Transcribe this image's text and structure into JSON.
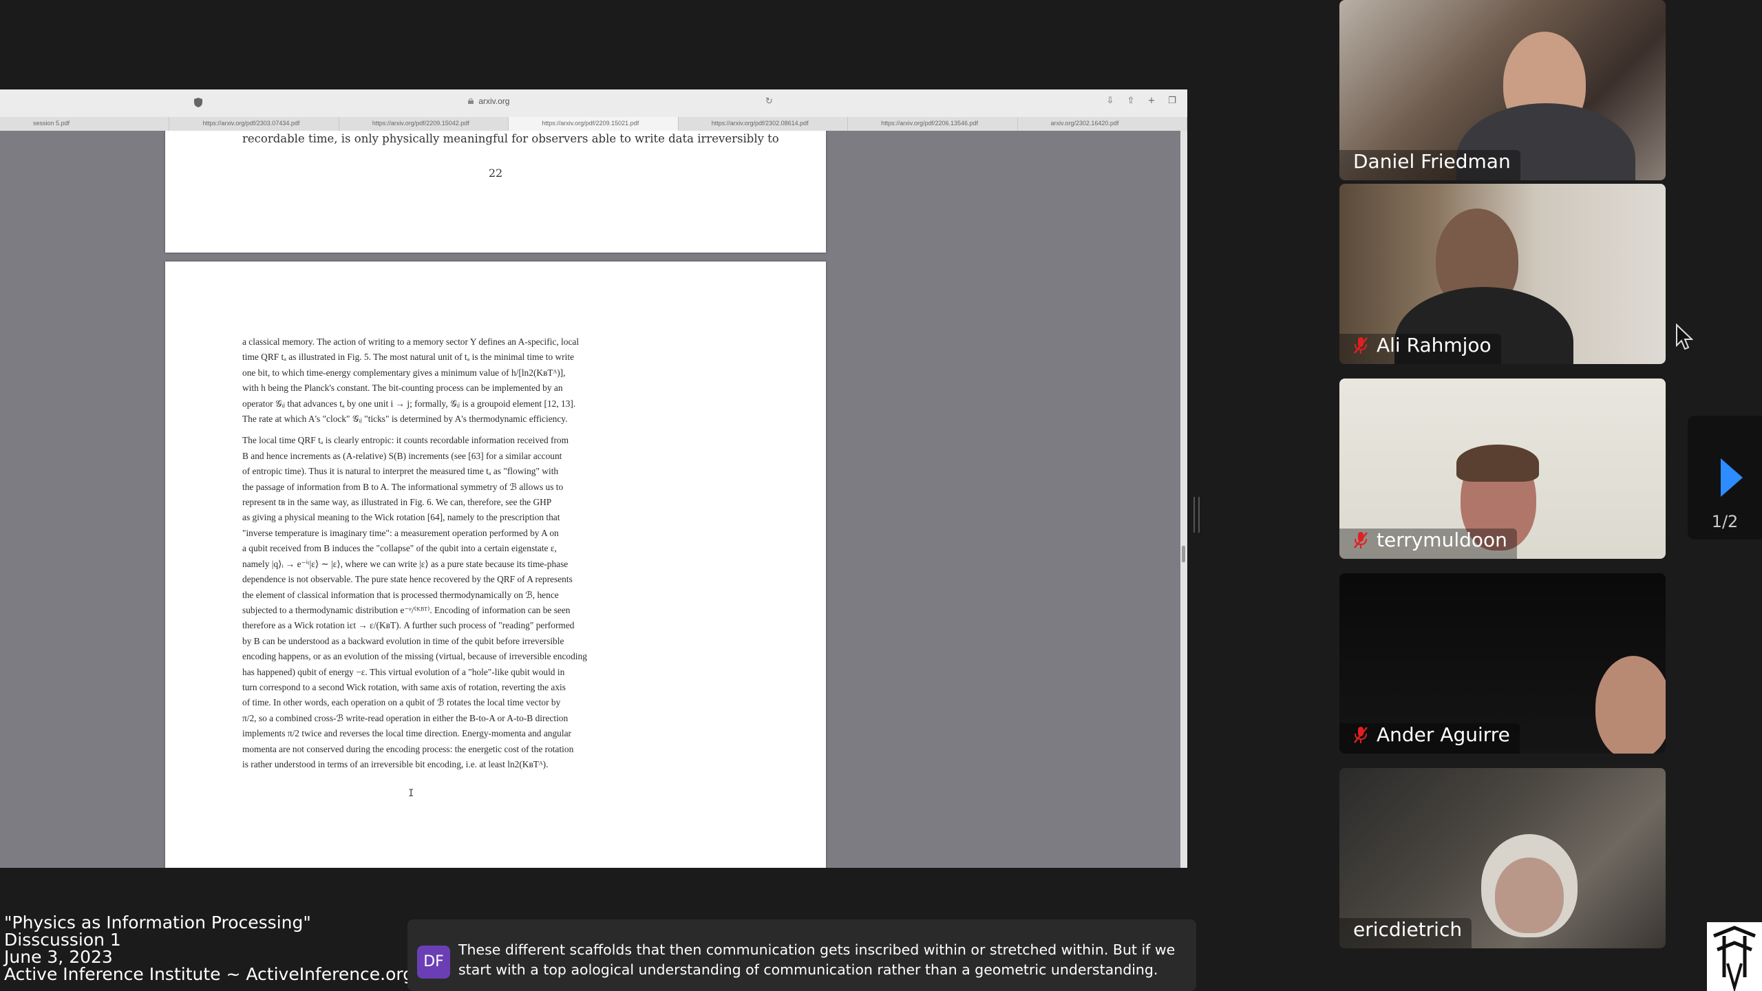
{
  "browser": {
    "url": "arxiv.org",
    "tabs": [
      "session 5.pdf",
      "https://arxiv.org/pdf/2303.07434.pdf",
      "https://arxiv.org/pdf/2209.15042.pdf",
      "https://arxiv.org/pdf/2209.15021.pdf",
      "https://arxiv.org/pdf/2302.08614.pdf",
      "https://arxiv.org/pdf/2206.13546.pdf",
      "arxiv.org/2302.16420.pdf"
    ]
  },
  "document": {
    "prev_page_last_line": "recordable time, is only physically meaningful for observers able to write data irreversibly to",
    "page_number": "22",
    "paragraph1": [
      "a classical memory. The action of writing to a memory sector Y defines an A-specific, local",
      "time QRF tₐ as illustrated in Fig. 5. The most natural unit of tₐ is the minimal time to write",
      "one bit, to which time-energy complementary gives a minimum value of h/[ln2(KʙTᴬ)],",
      "with h being the Planck's constant. The bit-counting process can be implemented by an",
      "operator 𝒢ᵢⱼ that advances tₐ by one unit i → j; formally, 𝒢ᵢⱼ is a groupoid element [12, 13].",
      "The rate at which A's \"clock\" 𝒢ᵢⱼ \"ticks\" is determined by A's thermodynamic efficiency."
    ],
    "paragraph2": [
      "The local time QRF tₐ is clearly entropic: it counts recordable information received from",
      "B and hence increments as (A-relative) S(B) increments (see [63] for a similar account",
      "of entropic time). Thus it is natural to interpret the measured time tₐ as \"flowing\" with",
      "the passage of information from B to A. The informational symmetry of ℬ allows us to",
      "represent tʙ in the same way, as illustrated in Fig. 6. We can, therefore, see the GHP",
      "as giving a physical meaning to the Wick rotation [64], namely to the prescription that",
      "\"inverse temperature is imaginary time\": a measurement operation performed by A on",
      "a qubit received from B induces the \"collapse\" of the qubit into a certain eigenstate ε,",
      "namely |q⟩ᵢ → e⁻ⁱᵗ|ε⟩ ∼ |ε⟩, where we can write |ε⟩ as a pure state because its time-phase",
      "dependence is not observable. The pure state hence recovered by the QRF of A represents",
      "the element of classical information that is processed thermodynamically on ℬ, hence",
      "subjected to a thermodynamic distribution e⁻ᵉ/⁽ᴷᴮᵀ⁾. Encoding of information can be seen",
      "therefore as a Wick rotation iεt → ε/(KʙT). A further such process of \"reading\" performed",
      "by B can be understood as a backward evolution in time of the qubit before irreversible",
      "encoding happens, or as an evolution of the missing (virtual, because of irreversible encoding",
      "has happened) qubit of energy −ε. This virtual evolution of a \"hole\"-like qubit would in",
      "turn correspond to a second Wick rotation, with same axis of rotation, reverting the axis",
      "of time. In other words, each operation on a qubit of ℬ rotates the local time vector by",
      "π/2, so a combined cross-ℬ write-read operation in either the B-to-A or A-to-B direction",
      "implements π/2 twice and reverses the local time direction. Energy-momenta and angular",
      "momenta are not conserved during the encoding process: the energetic cost of the rotation",
      "is rather understood in terms of an irreversible bit encoding, i.e. at least ln2(KʙTᴬ)."
    ]
  },
  "participants": [
    {
      "name": "Daniel Friedman",
      "muted": false
    },
    {
      "name": "Ali Rahmjoo",
      "muted": true
    },
    {
      "name": "terrymuldoon",
      "muted": true
    },
    {
      "name": "Ander Aguirre",
      "muted": true
    },
    {
      "name": "ericdietrich",
      "muted": false
    }
  ],
  "gallery_nav": {
    "page": "1/2"
  },
  "session_info": {
    "title": "\"Physics as Information Processing\"",
    "subtitle": "Disscussion 1",
    "date": "June 3, 2023",
    "org": "Active Inference Institute ~ ActiveInference.org"
  },
  "caption": {
    "initials": "DF",
    "text": "These different scaffolds that then communication gets inscribed within or stretched within. But if we start with a top aological understanding of communication rather than a geometric understanding."
  },
  "colors": {
    "accent": "#2d8cff",
    "muted_icon": "#e02020",
    "avatar": "#6a3fb5",
    "pdf_background": "#7d7c82"
  }
}
